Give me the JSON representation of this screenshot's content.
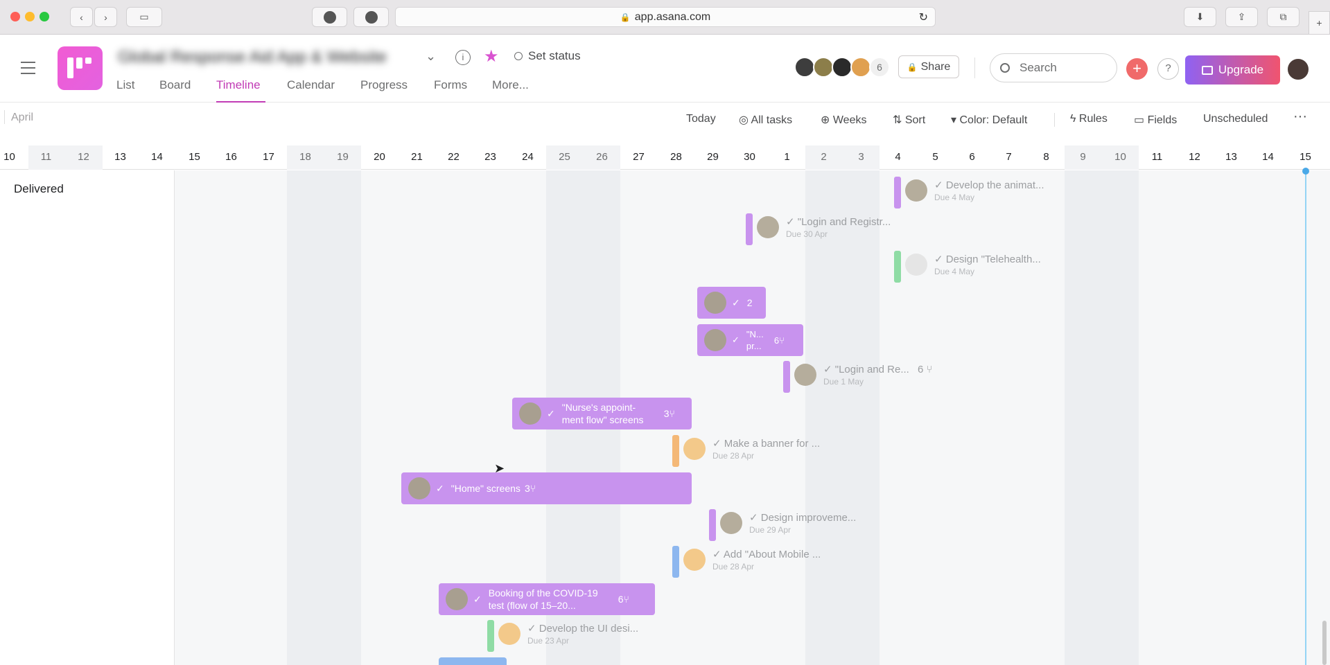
{
  "browser": {
    "url": "app.asana.com",
    "colors": {
      "close": "#fe5f57",
      "min": "#febc2e",
      "max": "#28c840"
    }
  },
  "project": {
    "title": "Global Response Aid App & Website",
    "status": "Set status"
  },
  "tabs": [
    "List",
    "Board",
    "Timeline",
    "Calendar",
    "Progress",
    "Forms",
    "More..."
  ],
  "header": {
    "member_count": "6",
    "share": "Share",
    "search_placeholder": "Search",
    "upgrade": "Upgrade",
    "help": "?",
    "add": "+"
  },
  "toolbar": {
    "month": "April",
    "today": "Today",
    "all_tasks": "All tasks",
    "weeks": "Weeks",
    "sort": "Sort",
    "color": "Color: Default",
    "rules": "Rules",
    "fields": "Fields",
    "unscheduled": "Unscheduled",
    "more": "···"
  },
  "dates": [
    "10",
    "11",
    "12",
    "13",
    "14",
    "15",
    "16",
    "17",
    "18",
    "19",
    "20",
    "21",
    "22",
    "23",
    "24",
    "25",
    "26",
    "27",
    "28",
    "29",
    "30",
    "1",
    "2",
    "3",
    "4",
    "5",
    "6",
    "7",
    "8",
    "9",
    "10",
    "11",
    "12",
    "13",
    "14",
    "15"
  ],
  "section": "Delivered",
  "tasks": {
    "t1": {
      "name": "Develop the animat...",
      "due": "Due 4 May"
    },
    "t2": {
      "name": "\"Login and Registr...",
      "due": "Due 30 Apr"
    },
    "t3": {
      "name": "Design \"Telehealth...",
      "due": "Due 4 May"
    },
    "t4": {
      "count": "2"
    },
    "t5": {
      "name": "\"N... pr...",
      "count": "6"
    },
    "t6": {
      "name": "\"Login and Re...",
      "count": "6",
      "due": "Due 1 May"
    },
    "t7": {
      "name": "\"Nurse's appoint-ment flow\" screens",
      "count": "3"
    },
    "t8": {
      "name": "Make a banner for ...",
      "due": "Due 28 Apr"
    },
    "t9": {
      "name": "\"Home\" screens",
      "count": "3"
    },
    "t10": {
      "name": "Design improveme...",
      "due": "Due 29 Apr"
    },
    "t11": {
      "name": "Add \"About Mobile ...",
      "due": "Due 28 Apr"
    },
    "t12": {
      "name": "Booking of the COVID-19 test (flow of 15–20...",
      "count": "6"
    },
    "t13": {
      "name": "Develop the UI desi...",
      "due": "Due 23 Apr"
    }
  }
}
